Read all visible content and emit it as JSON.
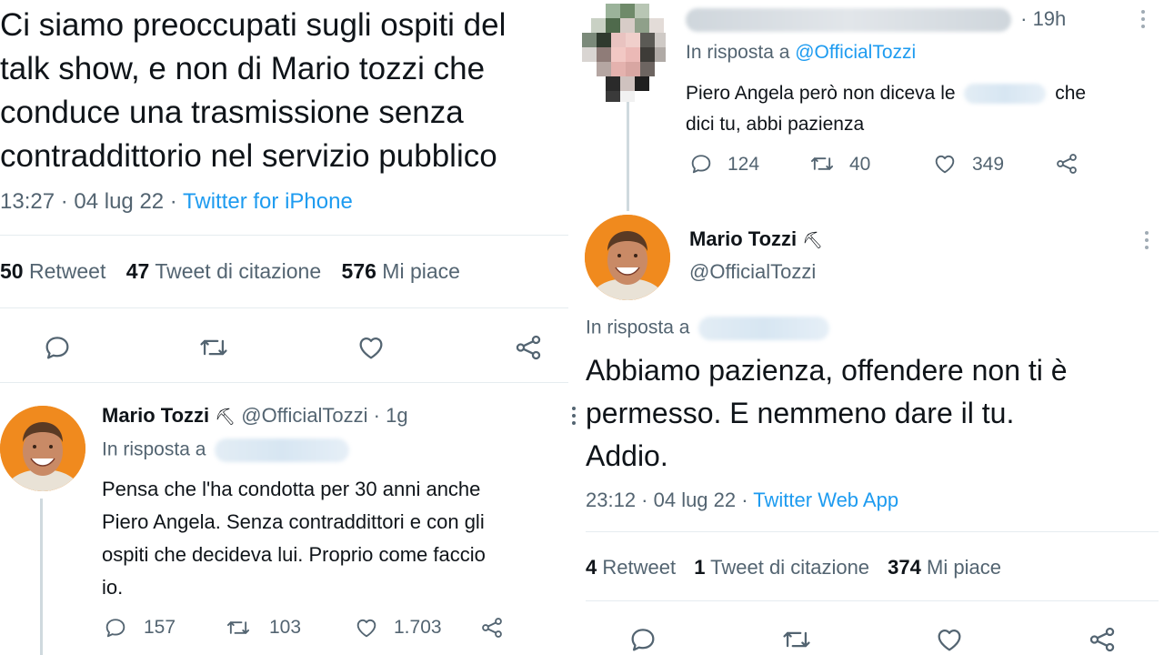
{
  "left": {
    "main_tweet": {
      "text_lines": [
        "Ci siamo preoccupati sugli ospiti del",
        "talk show, e non di Mario tozzi che",
        "conduce una trasmissione senza",
        "contraddittorio nel servizio pubblico"
      ],
      "time": "13:27 · 04 lug 22 · ",
      "source": "Twitter for iPhone",
      "retweets_count": "50",
      "retweets_label": " Retweet",
      "quotes_count": "47",
      "quotes_label": " Tweet di citazione",
      "likes_count": "576",
      "likes_label": " Mi piace"
    },
    "reply": {
      "name": "Mario Tozzi",
      "badge": "⛏",
      "handle": "@OfficialTozzi",
      "age": " · 1g",
      "reply_to": "In risposta a",
      "text_lines": [
        "Pensa che l'ha condotta per 30 anni anche",
        "Piero Angela. Senza contraddittori e con gli",
        "ospiti che decideva lui. Proprio come faccio",
        "io."
      ],
      "replies": "157",
      "retweets": "103",
      "likes": "1.703"
    }
  },
  "right": {
    "top_reply": {
      "age": "· 19h",
      "reply_to": "In risposta a ",
      "reply_to_handle": "@OfficialTozzi",
      "text_line1_start": "Piero Angela però non diceva le",
      "text_line1_end": "che",
      "text_line2": "dici tu, abbi pazienza",
      "replies": "124",
      "retweets": "40",
      "likes": "349"
    },
    "main_tweet": {
      "name": "Mario Tozzi",
      "badge": "⛏",
      "handle": "@OfficialTozzi",
      "reply_to": "In risposta a",
      "text_lines": [
        "Abbiamo pazienza, offendere non ti è",
        "permesso. E nemmeno dare il tu.",
        "Addio."
      ],
      "time": "23:12 · 04 lug 22 · ",
      "source": "Twitter Web App",
      "retweets_count": "4",
      "retweets_label": " Retweet",
      "quotes_count": "1",
      "quotes_label": " Tweet di citazione",
      "likes_count": "374",
      "likes_label": " Mi piace"
    }
  },
  "colors": {
    "text": "#0f1419",
    "muted": "#536471",
    "link": "#1d9bf0",
    "border": "#e6ecf0",
    "avatar_bg": "#f08a1e"
  },
  "icons": [
    "reply-icon",
    "retweet-icon",
    "like-icon",
    "share-icon",
    "more-icon",
    "pickaxe-icon"
  ]
}
